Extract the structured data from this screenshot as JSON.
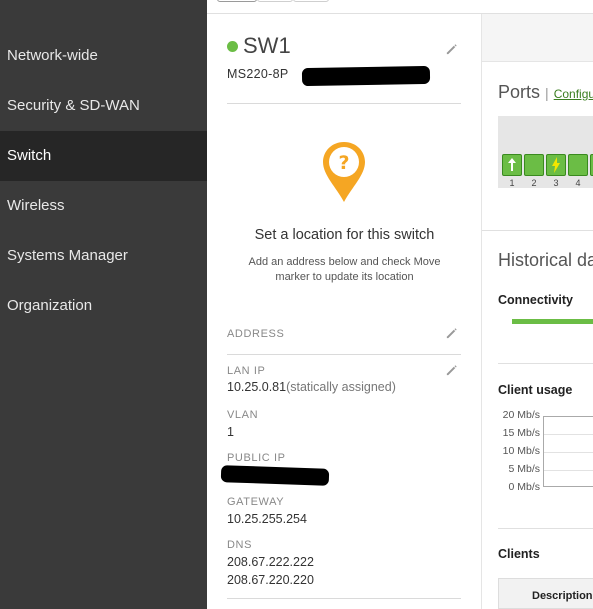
{
  "sidebar": {
    "items": [
      {
        "label": "Network-wide",
        "active": false
      },
      {
        "label": "Security & SD-WAN",
        "active": false
      },
      {
        "label": "Switch",
        "active": true
      },
      {
        "label": "Wireless",
        "active": false
      },
      {
        "label": "Systems Manager",
        "active": false
      },
      {
        "label": "Organization",
        "active": false
      }
    ]
  },
  "device": {
    "name": "SW1",
    "status_color": "#6bbd45",
    "model": "MS220-8P"
  },
  "location": {
    "title": "Set a location for this switch",
    "description": "Add an address below and check Move marker to update its location",
    "pin_symbol": "?",
    "pin_color": "#f5a623"
  },
  "details": {
    "address_label": "ADDRESS",
    "lan_ip_label": "LAN IP",
    "lan_ip_value": "10.25.0.81",
    "lan_ip_note": "(statically assigned)",
    "vlan_label": "VLAN",
    "vlan_value": "1",
    "public_ip_label": "PUBLIC IP",
    "gateway_label": "GATEWAY",
    "gateway_value": "10.25.255.254",
    "dns_label": "DNS",
    "dns_values": [
      "208.67.222.222",
      "208.67.220.220"
    ]
  },
  "ports": {
    "title": "Ports",
    "separator": "|",
    "link": "Configu",
    "port_numbers": [
      "1",
      "2",
      "3",
      "4"
    ]
  },
  "historical": {
    "title": "Historical da",
    "connectivity_label": "Connectivity",
    "client_usage_label": "Client usage",
    "y_axis_labels": [
      "20 Mb/s",
      "15 Mb/s",
      "10 Mb/s",
      "5 Mb/s",
      "0 Mb/s"
    ]
  },
  "clients": {
    "label": "Clients",
    "column_description": "Description"
  },
  "colors": {
    "sidebar_bg": "#3a3a3a",
    "sidebar_active": "#262626",
    "accent_green": "#6bbd45",
    "pin_orange": "#f5a623"
  }
}
